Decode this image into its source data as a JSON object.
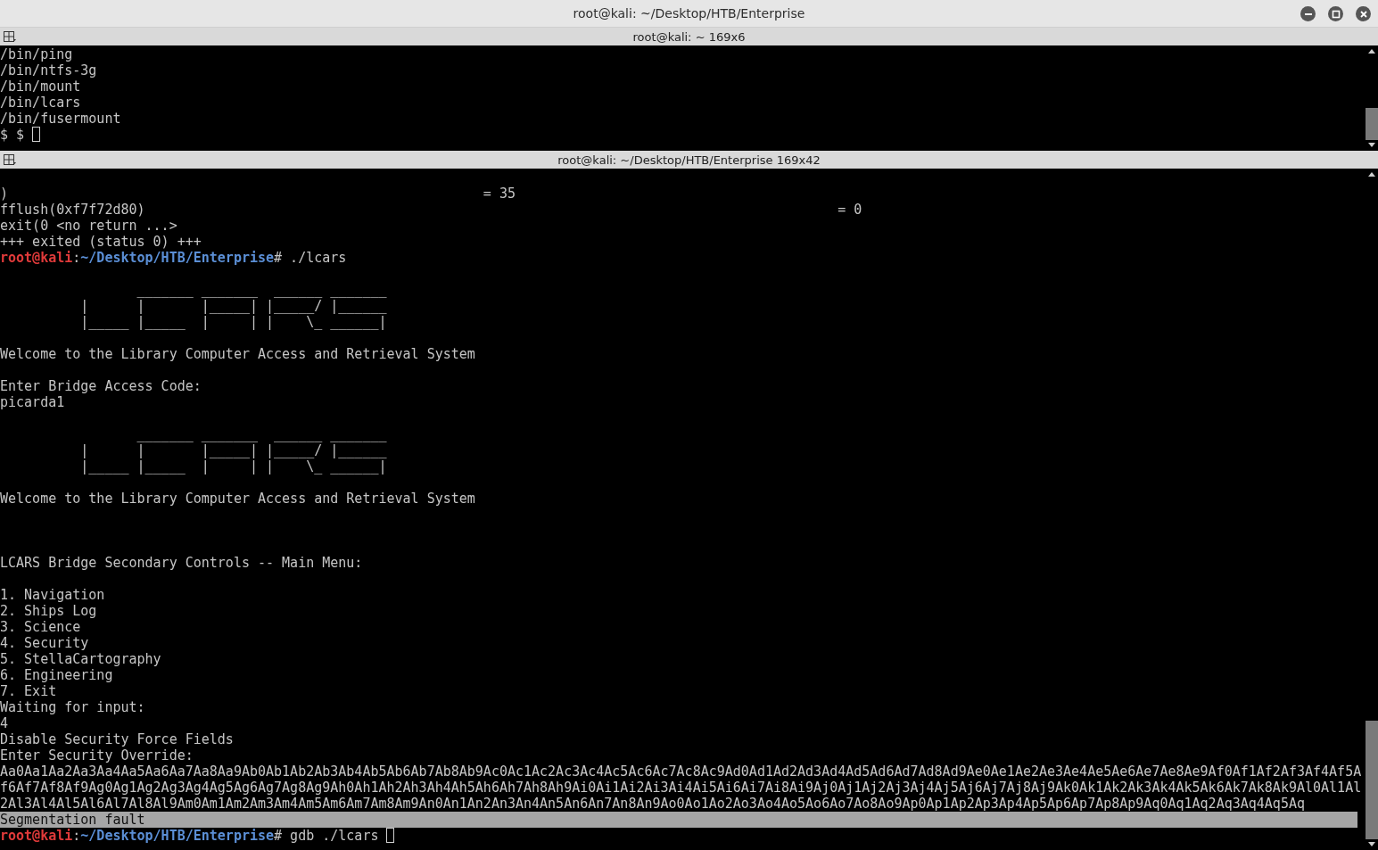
{
  "window": {
    "title": "root@kali: ~/Desktop/HTB/Enterprise"
  },
  "panes": [
    {
      "title": "root@kali: ~ 169x6",
      "lines": [
        {
          "kind": "text",
          "text": "/bin/ping"
        },
        {
          "kind": "text",
          "text": "/bin/ntfs-3g"
        },
        {
          "kind": "text",
          "text": "/bin/mount"
        },
        {
          "kind": "text",
          "text": "/bin/lcars"
        },
        {
          "kind": "text",
          "text": "/bin/fusermount"
        },
        {
          "kind": "text",
          "text": "$ $",
          "cursor": true
        }
      ]
    },
    {
      "title": "root@kali: ~/Desktop/HTB/Enterprise 169x42",
      "lines": [
        {
          "kind": "blank"
        },
        {
          "kind": "text",
          "text": ")                                                           = 35"
        },
        {
          "kind": "text",
          "text": "fflush(0xf7f72d80)                                                                                      = 0"
        },
        {
          "kind": "text",
          "text": "exit(0 <no return ...>"
        },
        {
          "kind": "text",
          "text": "+++ exited (status 0) +++"
        },
        {
          "kind": "prompt",
          "user": "root@kali",
          "sep": ":",
          "path": "~/Desktop/HTB/Enterprise",
          "rest": "# ./lcars"
        },
        {
          "kind": "blank"
        },
        {
          "kind": "art",
          "lines": [
            "                 _______ _______  ______ _______",
            "          |      |       |_____| |_____/ |______",
            "          |_____ |_____  |     | |    \\_ ______|"
          ]
        },
        {
          "kind": "blank"
        },
        {
          "kind": "text",
          "text": "Welcome to the Library Computer Access and Retrieval System"
        },
        {
          "kind": "blank"
        },
        {
          "kind": "text",
          "text": "Enter Bridge Access Code:"
        },
        {
          "kind": "text",
          "text": "picarda1"
        },
        {
          "kind": "blank"
        },
        {
          "kind": "art",
          "lines": [
            "                 _______ _______  ______ _______",
            "          |      |       |_____| |_____/ |______",
            "          |_____ |_____  |     | |    \\_ ______|"
          ]
        },
        {
          "kind": "blank"
        },
        {
          "kind": "text",
          "text": "Welcome to the Library Computer Access and Retrieval System"
        },
        {
          "kind": "blank"
        },
        {
          "kind": "blank"
        },
        {
          "kind": "blank"
        },
        {
          "kind": "text",
          "text": "LCARS Bridge Secondary Controls -- Main Menu:"
        },
        {
          "kind": "blank"
        },
        {
          "kind": "text",
          "text": "1. Navigation"
        },
        {
          "kind": "text",
          "text": "2. Ships Log"
        },
        {
          "kind": "text",
          "text": "3. Science"
        },
        {
          "kind": "text",
          "text": "4. Security"
        },
        {
          "kind": "text",
          "text": "5. StellaCartography"
        },
        {
          "kind": "text",
          "text": "6. Engineering"
        },
        {
          "kind": "text",
          "text": "7. Exit"
        },
        {
          "kind": "text",
          "text": "Waiting for input:"
        },
        {
          "kind": "text",
          "text": "4"
        },
        {
          "kind": "text",
          "text": "Disable Security Force Fields"
        },
        {
          "kind": "text",
          "text": "Enter Security Override:"
        },
        {
          "kind": "text",
          "text": "Aa0Aa1Aa2Aa3Aa4Aa5Aa6Aa7Aa8Aa9Ab0Ab1Ab2Ab3Ab4Ab5Ab6Ab7Ab8Ab9Ac0Ac1Ac2Ac3Ac4Ac5Ac6Ac7Ac8Ac9Ad0Ad1Ad2Ad3Ad4Ad5Ad6Ad7Ad8Ad9Ae0Ae1Ae2Ae3Ae4Ae5Ae6Ae7Ae8Ae9Af0Af1Af2Af3Af4Af5A"
        },
        {
          "kind": "text",
          "text": "f6Af7Af8Af9Ag0Ag1Ag2Ag3Ag4Ag5Ag6Ag7Ag8Ag9Ah0Ah1Ah2Ah3Ah4Ah5Ah6Ah7Ah8Ah9Ai0Ai1Ai2Ai3Ai4Ai5Ai6Ai7Ai8Ai9Aj0Aj1Aj2Aj3Aj4Aj5Aj6Aj7Aj8Aj9Ak0Ak1Ak2Ak3Ak4Ak5Ak6Ak7Ak8Ak9Al0Al1Al"
        },
        {
          "kind": "text",
          "text": "2Al3Al4Al5Al6Al7Al8Al9Am0Am1Am2Am3Am4Am5Am6Am7Am8Am9An0An1An2An3An4An5An6An7An8An9Ao0Ao1Ao2Ao3Ao4Ao5Ao6Ao7Ao8Ao9Ap0Ap1Ap2Ap3Ap4Ap5Ap6Ap7Ap8Ap9Aq0Aq1Aq2Aq3Aq4Aq5Aq"
        },
        {
          "kind": "text",
          "text": "Segmentation fault",
          "selected": true
        },
        {
          "kind": "prompt",
          "user": "root@kali",
          "sep": ":",
          "path": "~/Desktop/HTB/Enterprise",
          "rest": "# gdb ./lcars",
          "cursor": true
        }
      ]
    }
  ]
}
